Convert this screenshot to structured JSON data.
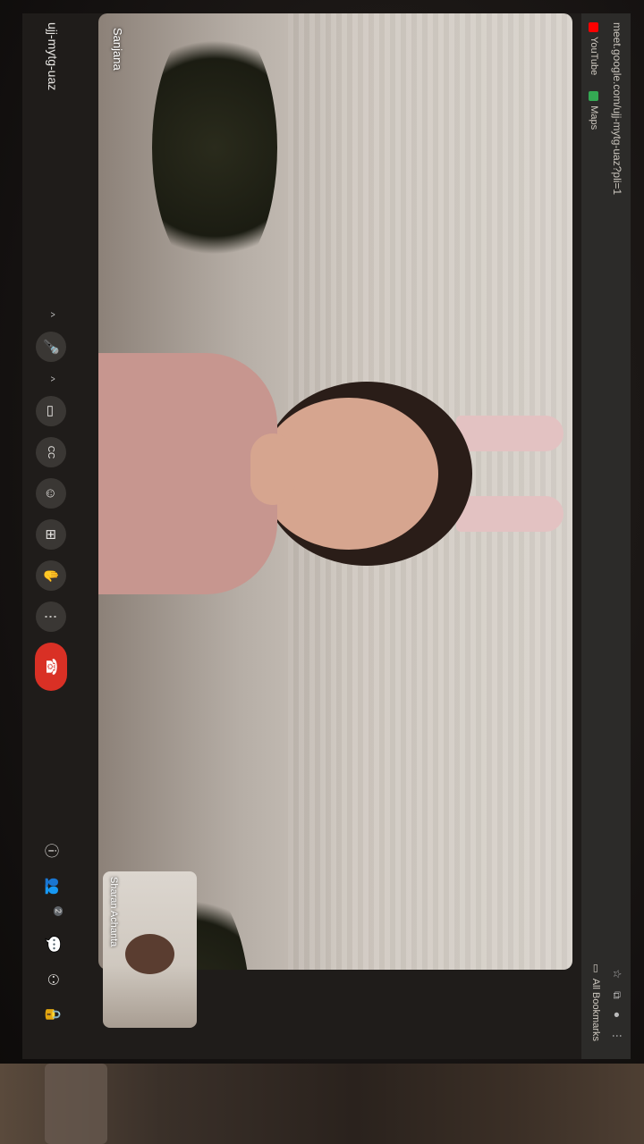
{
  "browser": {
    "url": "meet.google.com/ujj-mytg-uaz?pli=1",
    "bookmarks": [
      {
        "label": "YouTube",
        "color": "#ff0000"
      },
      {
        "label": "Maps",
        "color": "#34a853"
      }
    ],
    "all_bookmarks": "All Bookmarks"
  },
  "meeting": {
    "code": "ujj-mytg-uaz",
    "main_participant": "Sanjana",
    "self_participant": "Sharan Achanta",
    "participant_count": "2"
  },
  "controls": {
    "mic_chevron": "^",
    "mic": "🎤",
    "cam_chevron": "^",
    "camera": "▭",
    "captions": "CC",
    "emoji": "☺",
    "present": "⊞",
    "raise_hand": "✋",
    "more": "⋮",
    "end_call": "☎",
    "info": "ⓘ",
    "people": "👥",
    "chat": "💬",
    "activities": "⚇",
    "host_controls": "🔒"
  },
  "colors": {
    "end_call": "#d93025",
    "background": "#202124"
  }
}
